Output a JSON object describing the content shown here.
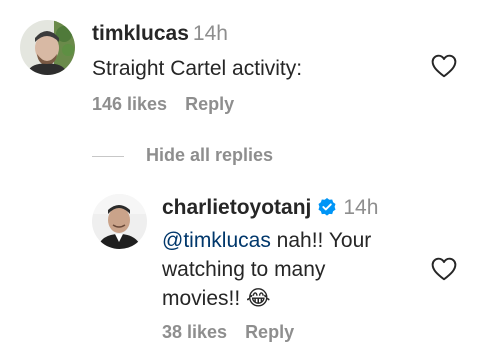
{
  "comment": {
    "username": "timklucas",
    "time": "14h",
    "text": "Straight Cartel activity:",
    "likes": "146 likes",
    "reply": "Reply"
  },
  "replies_toggle": {
    "label": "Hide all replies"
  },
  "reply_comment": {
    "username": "charlietoyotanj",
    "verified": true,
    "time": "14h",
    "mention": "@timklucas",
    "text_line1": " nah!! Your",
    "text_line2": "watching to many",
    "text_line3": "movies!!",
    "emoji": "😂",
    "likes": "38 likes",
    "reply": "Reply"
  },
  "colors": {
    "text": "#262626",
    "secondary": "#8e8e8e",
    "mention": "#00376b",
    "verified": "#0095f6"
  }
}
